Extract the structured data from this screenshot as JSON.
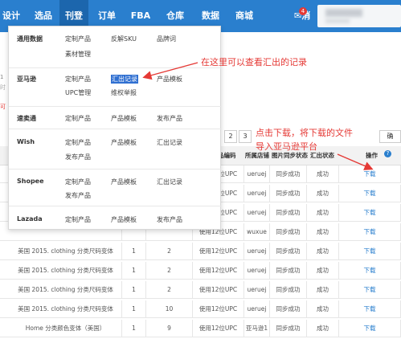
{
  "nav": {
    "items": [
      "设计",
      "选品",
      "刊登",
      "订单",
      "FBA",
      "仓库",
      "数据",
      "商城"
    ],
    "message_label": "消息",
    "message_badge": "4",
    "active": "刊登"
  },
  "menu": {
    "sections": [
      {
        "title": "通用数据",
        "items": [
          "定制产品",
          "反解SKU",
          "品牌词",
          "素材管理"
        ]
      },
      {
        "title": "亚马逊",
        "items": [
          "定制产品",
          "汇出记录",
          "产品模板",
          "UPC管理",
          "维权举报"
        ],
        "selected": "汇出记录"
      },
      {
        "title": "速卖通",
        "items": [
          "定制产品",
          "产品模板",
          "发布产品"
        ]
      },
      {
        "title": "Wish",
        "items": [
          "定制产品",
          "产品模板",
          "汇出记录",
          "发布产品"
        ]
      },
      {
        "title": "Shopee",
        "items": [
          "定制产品",
          "产品模板",
          "汇出记录",
          "发布产品"
        ]
      },
      {
        "title": "Lazada",
        "items": [
          "定制产品",
          "产品模板",
          "发布产品"
        ]
      }
    ]
  },
  "annotations": {
    "note1": "在这里可以查看汇出的记录",
    "note2a": "点击下载，将下载的文件",
    "note2b": "导入亚马逊平台"
  },
  "pagination": [
    "2",
    "3"
  ],
  "toolbar_right": "确",
  "table": {
    "headers": [
      "品编码",
      "所属店铺",
      "图片同步状态",
      "汇出状态",
      "操作"
    ],
    "rows": [
      {
        "name": "",
        "c1": "",
        "c2": "",
        "code": "使用12位UPC",
        "shop": "ueruej",
        "img": "同步成功",
        "status": "成功",
        "op": "下载"
      },
      {
        "name": "",
        "c1": "",
        "c2": "",
        "code": "使用12位UPC",
        "shop": "ueruej",
        "img": "同步成功",
        "status": "成功",
        "op": "下载"
      },
      {
        "name": "",
        "c1": "",
        "c2": "",
        "code": "使用12位UPC",
        "shop": "ueruej",
        "img": "同步成功",
        "status": "成功",
        "op": "下载"
      },
      {
        "name": "",
        "c1": "",
        "c2": "",
        "code": "使用12位UPC",
        "shop": "wuxue",
        "img": "同步成功",
        "status": "成功",
        "op": "下载"
      },
      {
        "name": "美国 2015. clothing 分类尺码变体",
        "c1": "1",
        "c2": "2",
        "code": "使用12位UPC",
        "shop": "ueruej",
        "img": "同步成功",
        "status": "成功",
        "op": "下载"
      },
      {
        "name": "美国 2015. clothing 分类尺码变体",
        "c1": "1",
        "c2": "2",
        "code": "使用12位UPC",
        "shop": "ueruej",
        "img": "同步成功",
        "status": "成功",
        "op": "下载"
      },
      {
        "name": "美国 2015. clothing 分类尺码变体",
        "c1": "1",
        "c2": "2",
        "code": "使用12位UPC",
        "shop": "ueruej",
        "img": "同步成功",
        "status": "成功",
        "op": "下载"
      },
      {
        "name": "美国 2015. clothing 分类尺码变体",
        "c1": "1",
        "c2": "10",
        "code": "使用12位UPC",
        "shop": "ueruej",
        "img": "同步成功",
        "status": "成功",
        "op": "下载"
      },
      {
        "name": "Home 分类颜色变体（美国）",
        "c1": "1",
        "c2": "9",
        "code": "使用12位UPC",
        "shop": "亚马逊1",
        "img": "同步成功",
        "status": "成功",
        "op": "下载"
      }
    ]
  },
  "colors": {
    "nav_bg": "#2a7fce",
    "annotation": "#e53935",
    "link": "#2a7fce",
    "selected": "#2f6fd1"
  }
}
